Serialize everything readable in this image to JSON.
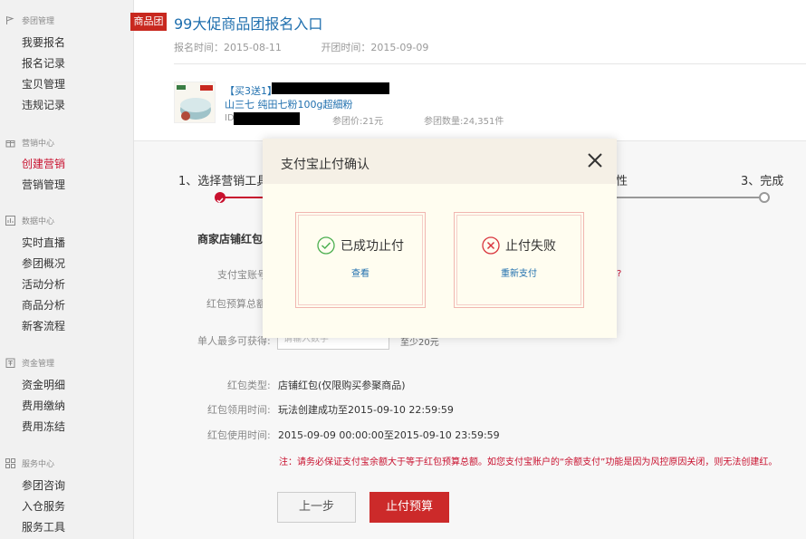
{
  "sidebar": {
    "groups": [
      {
        "title": "参团管理",
        "icon": "flag-icon",
        "items": [
          "我要报名",
          "报名记录",
          "宝贝管理",
          "违规记录"
        ]
      },
      {
        "title": "营销中心",
        "icon": "gift-icon",
        "items": [
          "创建营销",
          "营销管理"
        ]
      },
      {
        "title": "数据中心",
        "icon": "chart-icon",
        "items": [
          "实时直播",
          "参团概况",
          "活动分析",
          "商品分析",
          "新客流程"
        ]
      },
      {
        "title": "资金管理",
        "icon": "wallet-icon",
        "items": [
          "资金明细",
          "费用缴纳",
          "费用冻结"
        ]
      },
      {
        "title": "服务中心",
        "icon": "grid-icon",
        "items": [
          "参团咨询",
          "入仓服务",
          "服务工具"
        ]
      }
    ],
    "active_item": "创建营销"
  },
  "header": {
    "tag": "商品团",
    "title": "99大促商品团报名入口",
    "signup_time": "报名时间：2015-08-11",
    "open_time": "开团时间：2015-09-09"
  },
  "product": {
    "title_prefix": "【买3送1】",
    "title_line2": "山三七 纯田七粉100g超細粉",
    "id_label": "ID:",
    "price": "参团价:21元",
    "quantity": "参团数量:24,351件"
  },
  "steps": {
    "step1": "1、选择营销工具",
    "step2_tail": "性",
    "step3": "3、完成"
  },
  "form": {
    "section_title": "商家店铺红包",
    "alipay_label": "支付宝账号",
    "alipay_tail": "?",
    "budget_label": "红包预算总额",
    "per_person_label": "单人最多可获得:",
    "per_person_placeholder": "请输入数字",
    "per_person_hint": "至少20元",
    "type_label": "红包类型:",
    "type_value": "店铺红包(仅限购买参聚商品)",
    "claim_label": "红包领用时间:",
    "claim_value": "玩法创建成功至2015-09-10 22:59:59",
    "use_label": "红包使用时间:",
    "use_value": "2015-09-09 00:00:00至2015-09-10  23:59:59",
    "note": "注：请务必保证支付宝余额大于等于红包预算总额。如您支付宝账户的“余额支付”功能是因为风控原因关闭，则无法创建红。",
    "prev_button": "上一步",
    "stop_button": "止付预算"
  },
  "modal": {
    "title": "支付宝止付确认",
    "success_label": "已成功止付",
    "success_link": "查看",
    "fail_label": "止付失败",
    "fail_link": "重新支付"
  },
  "colors": {
    "accent_red": "#c8102e",
    "link_blue": "#1f6fae",
    "success_green": "#4caf50",
    "fail_red": "#d9363e"
  }
}
